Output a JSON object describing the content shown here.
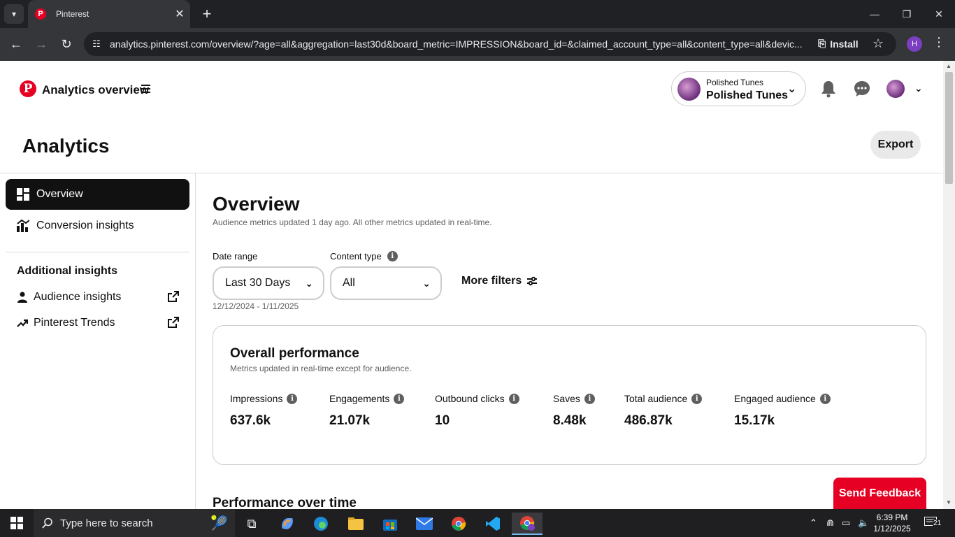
{
  "browser": {
    "tab_title": "Pinterest",
    "url": "analytics.pinterest.com/overview/?age=all&aggregation=last30d&board_metric=IMPRESSION&board_id=&claimed_account_type=all&content_type=all&devic...",
    "install_label": "Install",
    "profile_initial": "H"
  },
  "header": {
    "title": "Analytics overview",
    "account_small": "Polished Tunes",
    "account_name": "Polished Tunes"
  },
  "page": {
    "heading": "Analytics",
    "export_label": "Export"
  },
  "sidebar": {
    "items": [
      {
        "label": "Overview",
        "active": true
      },
      {
        "label": "Conversion insights",
        "active": false
      }
    ],
    "additional_heading": "Additional insights",
    "links": [
      {
        "label": "Audience insights"
      },
      {
        "label": "Pinterest Trends"
      }
    ]
  },
  "main": {
    "title": "Overview",
    "subtitle": "Audience metrics updated 1 day ago. All other metrics updated in real-time.",
    "date_range_label": "Date range",
    "date_range_value": "Last 30 Days",
    "date_range_note": "12/12/2024 - 1/11/2025",
    "content_type_label": "Content type",
    "content_type_value": "All",
    "more_filters_label": "More filters"
  },
  "overall": {
    "title": "Overall performance",
    "subtitle": "Metrics updated in real-time except for audience.",
    "metrics": [
      {
        "label": "Impressions",
        "value": "637.6k"
      },
      {
        "label": "Engagements",
        "value": "21.07k"
      },
      {
        "label": "Outbound clicks",
        "value": "10"
      },
      {
        "label": "Saves",
        "value": "8.48k"
      },
      {
        "label": "Total audience",
        "value": "486.87k"
      },
      {
        "label": "Engaged audience",
        "value": "15.17k"
      }
    ]
  },
  "performance_title": "Performance over time",
  "feedback_label": "Send Feedback",
  "taskbar": {
    "search_placeholder": "Type here to search",
    "time": "6:39 PM",
    "date": "1/12/2025",
    "notification_count": "21"
  },
  "colors": {
    "brand_red": "#e60023",
    "active_nav": "#111111"
  }
}
